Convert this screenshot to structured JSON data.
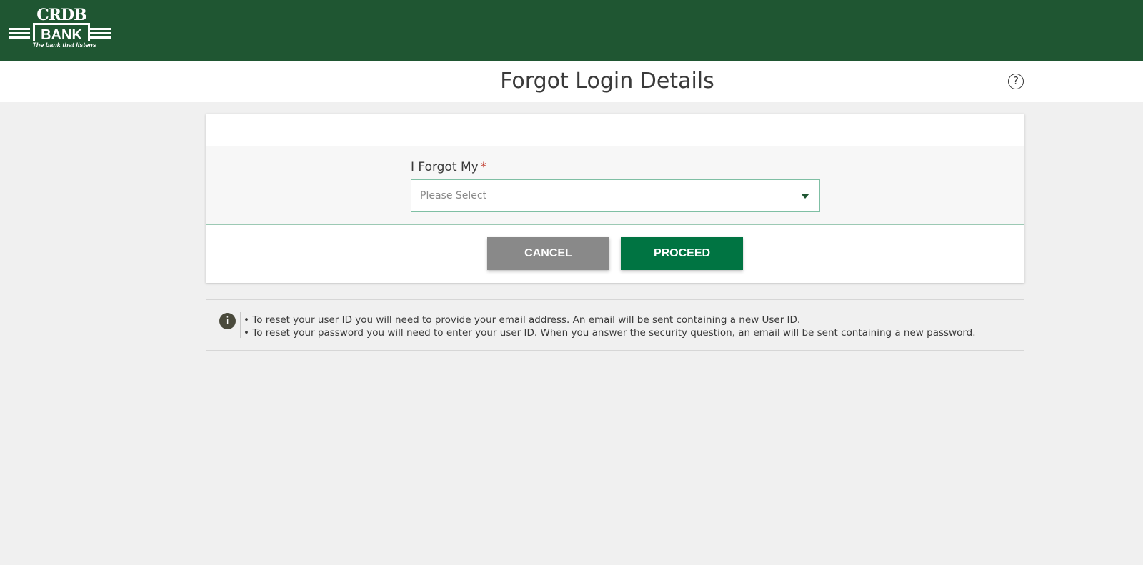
{
  "header": {
    "logo_mark": "CRDB",
    "logo_word": "BANK",
    "logo_tagline": "The bank that listens",
    "brand_color": "#1f5632"
  },
  "title_bar": {
    "title": "Forgot Login Details",
    "help_icon": "question-circle-icon",
    "help_glyph": "?"
  },
  "form": {
    "field_label": "I Forgot My",
    "required_marker": "*",
    "select_placeholder": "Please Select",
    "select_caret_icon": "caret-down-icon"
  },
  "actions": {
    "cancel_label": "CANCEL",
    "proceed_label": "PROCEED",
    "cancel_color": "#898989",
    "proceed_color": "#007442"
  },
  "info": {
    "icon": "info-icon",
    "icon_glyph": "i",
    "lines": [
      "• To reset your user ID you will need to provide your email address. An email will be sent containing a new User ID.",
      "• To reset your password you will need to enter your user ID. When you answer the security question, an email will be sent containing a new password."
    ]
  }
}
